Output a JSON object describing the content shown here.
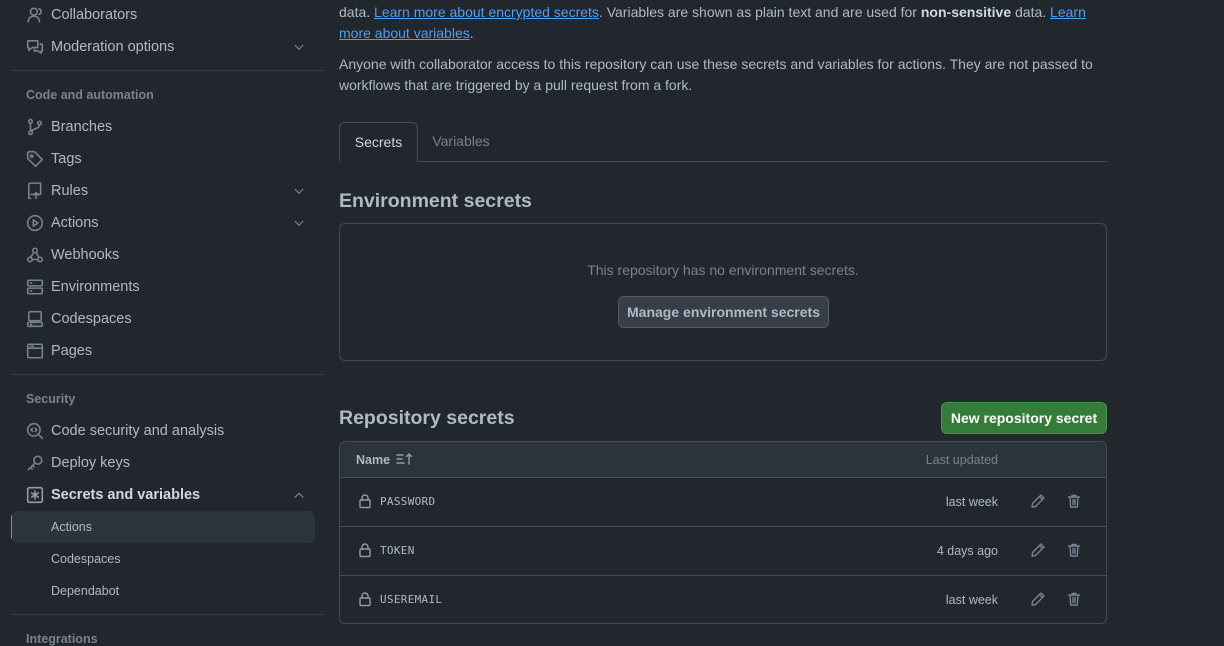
{
  "sidebar": {
    "top_items": [
      {
        "label": "Collaborators",
        "icon": "person-icon"
      },
      {
        "label": "Moderation options",
        "icon": "comment-discussion-icon",
        "expandable": true
      }
    ],
    "code_section_heading": "Code and automation",
    "code_items": [
      {
        "label": "Branches",
        "icon": "git-branch-icon"
      },
      {
        "label": "Tags",
        "icon": "tag-icon"
      },
      {
        "label": "Rules",
        "icon": "repo-push-icon",
        "expandable": true
      },
      {
        "label": "Actions",
        "icon": "play-icon",
        "expandable": true
      },
      {
        "label": "Webhooks",
        "icon": "webhook-icon"
      },
      {
        "label": "Environments",
        "icon": "server-icon"
      },
      {
        "label": "Codespaces",
        "icon": "codespaces-icon"
      },
      {
        "label": "Pages",
        "icon": "browser-icon"
      }
    ],
    "security_section_heading": "Security",
    "security_items": [
      {
        "label": "Code security and analysis",
        "icon": "codescan-icon"
      },
      {
        "label": "Deploy keys",
        "icon": "key-icon"
      },
      {
        "label": "Secrets and variables",
        "icon": "key-asterisk-icon",
        "expanded": true
      }
    ],
    "secrets_subitems": [
      {
        "label": "Actions",
        "selected": true
      },
      {
        "label": "Codespaces"
      },
      {
        "label": "Dependabot"
      }
    ],
    "integrations_section_heading": "Integrations"
  },
  "main": {
    "intro": {
      "line1_prefix": "data. ",
      "link_encrypted": "Learn more about encrypted secrets",
      "line1_mid": ". Variables are shown as plain text and are used for ",
      "bold_text": "non-sensitive",
      "line1_suffix": " data. ",
      "link_variables": "Learn more about variables",
      "end_period": ".",
      "paragraph2": "Anyone with collaborator access to this repository can use these secrets and variables for actions. They are not passed to workflows that are triggered by a pull request from a fork."
    },
    "tabs": [
      {
        "label": "Secrets",
        "active": true
      },
      {
        "label": "Variables",
        "active": false
      }
    ],
    "environment": {
      "heading": "Environment secrets",
      "empty_text": "This repository has no environment secrets.",
      "manage_button": "Manage environment secrets"
    },
    "repository": {
      "heading": "Repository secrets",
      "new_button": "New repository secret",
      "col_name": "Name",
      "col_updated": "Last updated",
      "rows": [
        {
          "name": "PASSWORD",
          "updated": "last week"
        },
        {
          "name": "TOKEN",
          "updated": "4 days ago"
        },
        {
          "name": "USEREMAIL",
          "updated": "last week"
        }
      ]
    }
  },
  "colors": {
    "background": "#22272e",
    "accent_link": "#539bf5",
    "primary_button": "#347d39",
    "border": "#444c56"
  }
}
